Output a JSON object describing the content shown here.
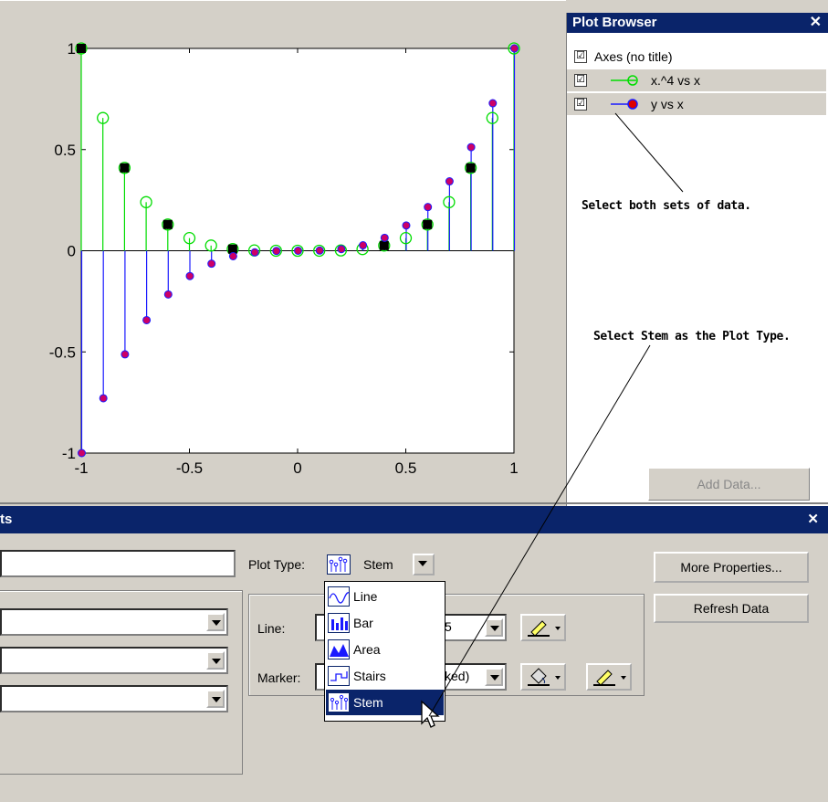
{
  "chart_data": {
    "type": "scatter",
    "xlim": [
      -1,
      1
    ],
    "ylim": [
      -1,
      1
    ],
    "x_ticks": [
      "-1",
      "-0.5",
      "0",
      "0.5",
      "1"
    ],
    "y_ticks": [
      "1",
      "0.5",
      "0",
      "-0.5",
      "-1"
    ],
    "x": [
      -1,
      -0.9,
      -0.8,
      -0.7,
      -0.6,
      -0.5,
      -0.4,
      -0.3,
      -0.2,
      -0.1,
      0,
      0.1,
      0.2,
      0.3,
      0.4,
      0.5,
      0.6,
      0.7,
      0.8,
      0.9,
      1
    ],
    "series": [
      {
        "name": "x.^4 vs x",
        "style": "stem-open-circle",
        "color": "#00dd00",
        "values": [
          1,
          0.6561,
          0.4096,
          0.2401,
          0.1296,
          0.0625,
          0.0256,
          0.0081,
          0.0016,
          0.0001,
          0,
          0.0001,
          0.0016,
          0.0081,
          0.0256,
          0.0625,
          0.1296,
          0.2401,
          0.4096,
          0.6561,
          1
        ]
      },
      {
        "name": "y vs x",
        "style": "stem-filled-dot",
        "color": "#1a1aff",
        "values": [
          -1,
          -0.729,
          -0.512,
          -0.343,
          -0.216,
          -0.125,
          -0.064,
          -0.027,
          -0.008,
          -0.001,
          0,
          0.001,
          0.008,
          0.027,
          0.064,
          0.125,
          0.216,
          0.343,
          0.512,
          0.729,
          1
        ]
      }
    ]
  },
  "plot_browser": {
    "title": "Plot Browser",
    "close": "✕",
    "items": [
      {
        "label": "Axes (no title)",
        "checked": "☑"
      },
      {
        "label": "x.^4 vs x",
        "checked": "☑"
      },
      {
        "label": "y vs x",
        "checked": "☑"
      }
    ],
    "add_data": "Add Data..."
  },
  "annotations": {
    "select_both": "Select both sets of data.",
    "select_stem": "Select Stem as the Plot Type."
  },
  "property_editor": {
    "title": "ts",
    "close": "✕",
    "plot_type_label": "Plot Type:",
    "plot_type_value": "Stem",
    "line_label": "Line:",
    "line_value_visible": "5",
    "marker_label": "Marker:",
    "marker_value_visible": "ked)",
    "more_properties": "More Properties...",
    "refresh_data": "Refresh Data",
    "plot_type_options": [
      "Line",
      "Bar",
      "Area",
      "Stairs",
      "Stem"
    ]
  }
}
